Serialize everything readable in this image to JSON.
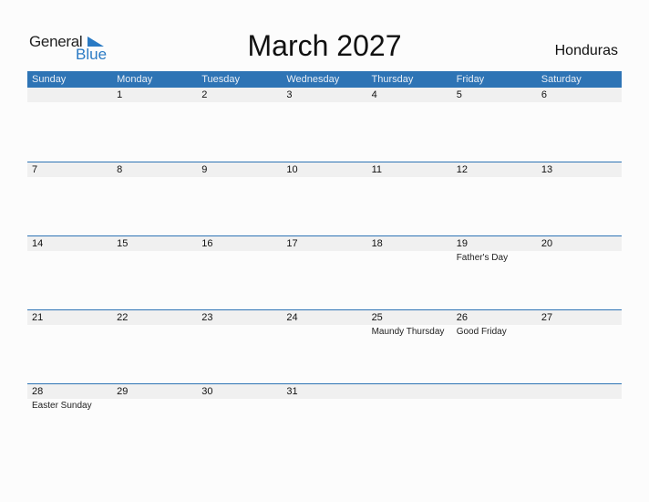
{
  "logo": {
    "word1": "General",
    "word2": "Blue"
  },
  "title": "March 2027",
  "country": "Honduras",
  "colors": {
    "accent": "#2e74b5",
    "band": "#f0f0f0",
    "logo_blue": "#2a7ac4"
  },
  "weekdays": [
    "Sunday",
    "Monday",
    "Tuesday",
    "Wednesday",
    "Thursday",
    "Friday",
    "Saturday"
  ],
  "weeks": [
    [
      {
        "d": ""
      },
      {
        "d": "1"
      },
      {
        "d": "2"
      },
      {
        "d": "3"
      },
      {
        "d": "4"
      },
      {
        "d": "5"
      },
      {
        "d": "6"
      }
    ],
    [
      {
        "d": "7"
      },
      {
        "d": "8"
      },
      {
        "d": "9"
      },
      {
        "d": "10"
      },
      {
        "d": "11"
      },
      {
        "d": "12"
      },
      {
        "d": "13"
      }
    ],
    [
      {
        "d": "14"
      },
      {
        "d": "15"
      },
      {
        "d": "16"
      },
      {
        "d": "17"
      },
      {
        "d": "18"
      },
      {
        "d": "19",
        "e": "Father's Day"
      },
      {
        "d": "20"
      }
    ],
    [
      {
        "d": "21"
      },
      {
        "d": "22"
      },
      {
        "d": "23"
      },
      {
        "d": "24"
      },
      {
        "d": "25",
        "e": "Maundy Thursday"
      },
      {
        "d": "26",
        "e": "Good Friday"
      },
      {
        "d": "27"
      }
    ],
    [
      {
        "d": "28",
        "e": "Easter Sunday"
      },
      {
        "d": "29"
      },
      {
        "d": "30"
      },
      {
        "d": "31"
      },
      {
        "d": ""
      },
      {
        "d": ""
      },
      {
        "d": ""
      }
    ]
  ]
}
